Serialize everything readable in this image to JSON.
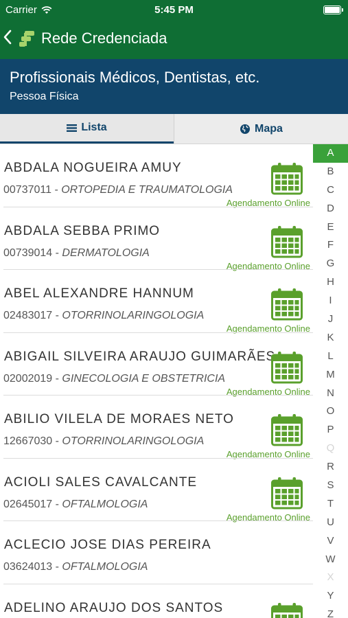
{
  "status": {
    "carrier": "Carrier",
    "time": "5:45 PM"
  },
  "nav": {
    "back_icon": "chevron-left-icon",
    "title": "Rede Credenciada"
  },
  "header": {
    "title": "Profissionais Médicos, Dentistas, etc.",
    "subtitle": "Pessoa Física"
  },
  "tabs": [
    {
      "label": "Lista",
      "icon": "list-icon",
      "active": true
    },
    {
      "label": "Mapa",
      "icon": "globe-icon",
      "active": false
    }
  ],
  "online_label": "Agendamento Online",
  "providers": [
    {
      "name": "ABDALA NOGUEIRA AMUY",
      "code": "00737011",
      "specialty": "ORTOPEDIA E TRAUMATOLOGIA",
      "online": true
    },
    {
      "name": "ABDALA SEBBA PRIMO",
      "code": "00739014",
      "specialty": "DERMATOLOGIA",
      "online": true
    },
    {
      "name": "ABEL ALEXANDRE HANNUM",
      "code": "02483017",
      "specialty": "OTORRINOLARINGOLOGIA",
      "online": true
    },
    {
      "name": "ABIGAIL SILVEIRA ARAUJO GUIMARÃES",
      "code": "02002019",
      "specialty": "GINECOLOGIA E OBSTETRICIA",
      "online": true
    },
    {
      "name": "ABILIO VILELA DE MORAES NETO",
      "code": "12667030",
      "specialty": "OTORRINOLARINGOLOGIA",
      "online": true
    },
    {
      "name": "ACIOLI SALES CAVALCANTE",
      "code": "02645017",
      "specialty": "OFTALMOLOGIA",
      "online": true
    },
    {
      "name": "ACLECIO JOSE DIAS PEREIRA",
      "code": "03624013",
      "specialty": "OFTALMOLOGIA",
      "online": false
    },
    {
      "name": "ADELINO ARAUJO DOS SANTOS",
      "code": "",
      "specialty": "",
      "online": true
    }
  ],
  "alphabet": [
    "A",
    "B",
    "C",
    "D",
    "E",
    "F",
    "G",
    "H",
    "I",
    "J",
    "K",
    "L",
    "M",
    "N",
    "O",
    "P",
    "Q",
    "R",
    "S",
    "T",
    "U",
    "V",
    "W",
    "X",
    "Y",
    "Z"
  ],
  "alphabet_selected": "A",
  "alphabet_disabled": [
    "Q",
    "X"
  ],
  "colors": {
    "nav_green": "#0f6e34",
    "header_blue": "#11456b",
    "accent_green": "#5aa02c",
    "index_selected": "#3aa13a"
  }
}
